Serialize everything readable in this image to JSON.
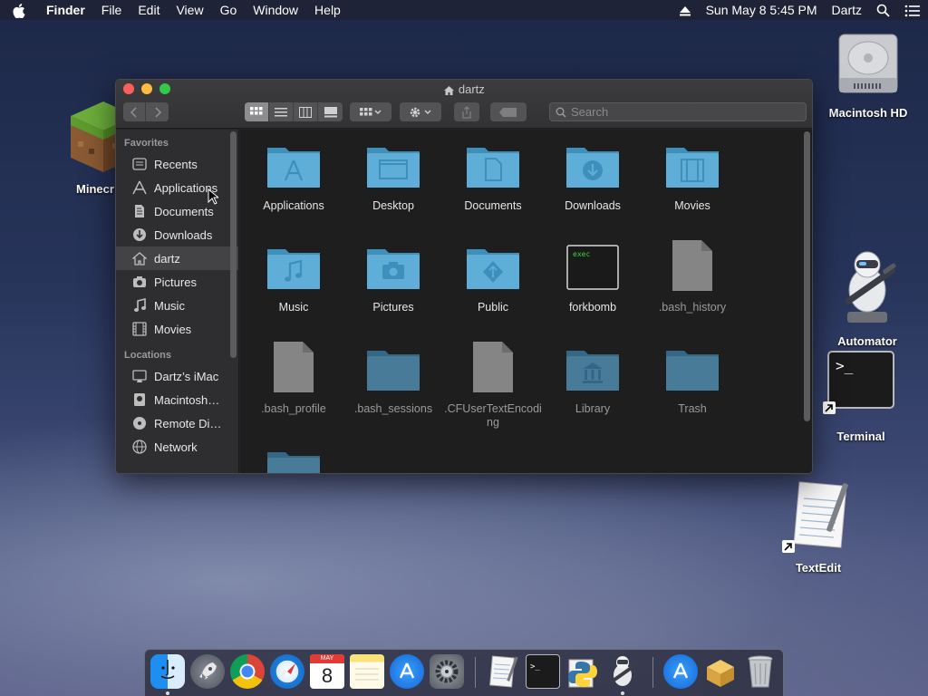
{
  "menubar": {
    "app": "Finder",
    "items": [
      "File",
      "Edit",
      "View",
      "Go",
      "Window",
      "Help"
    ],
    "clock": "Sun May 8  5:45 PM",
    "user": "Dartz"
  },
  "desktop": {
    "minecraft_label": "Minecr",
    "macintosh_hd": "Macintosh HD",
    "automator": "Automator",
    "terminal": "Terminal",
    "textedit": "TextEdit"
  },
  "window": {
    "title": "dartz",
    "search_placeholder": "Search"
  },
  "sidebar": {
    "favorites_header": "Favorites",
    "favorites": [
      {
        "label": "Recents",
        "icon": "recents-icon"
      },
      {
        "label": "Applications",
        "icon": "applications-icon"
      },
      {
        "label": "Documents",
        "icon": "documents-icon"
      },
      {
        "label": "Downloads",
        "icon": "downloads-icon"
      },
      {
        "label": "dartz",
        "icon": "home-icon"
      },
      {
        "label": "Pictures",
        "icon": "pictures-icon"
      },
      {
        "label": "Music",
        "icon": "music-icon"
      },
      {
        "label": "Movies",
        "icon": "movies-icon"
      }
    ],
    "locations_header": "Locations",
    "locations": [
      {
        "label": "Dartz’s iMac",
        "icon": "imac-icon"
      },
      {
        "label": "Macintosh…",
        "icon": "disk-icon"
      },
      {
        "label": "Remote Di…",
        "icon": "remote-disc-icon"
      },
      {
        "label": "Network",
        "icon": "network-icon"
      }
    ]
  },
  "files": [
    {
      "name": "Applications"
    },
    {
      "name": "Desktop"
    },
    {
      "name": "Documents"
    },
    {
      "name": "Downloads"
    },
    {
      "name": "Movies"
    },
    {
      "name": "Music"
    },
    {
      "name": "Pictures"
    },
    {
      "name": "Public"
    },
    {
      "name": "forkbomb",
      "exec_label": "exec"
    },
    {
      "name": ".bash_history"
    },
    {
      "name": ".bash_profile"
    },
    {
      "name": ".bash_sessions"
    },
    {
      "name": ".CFUserTextEncoding"
    },
    {
      "name": "Library"
    },
    {
      "name": "Trash"
    }
  ],
  "calendar": {
    "month": "MAY",
    "day": "8"
  },
  "colors": {
    "folder": "#5eaed8",
    "folder_dark": "#3f8fbd",
    "accent": "#34c84a"
  }
}
